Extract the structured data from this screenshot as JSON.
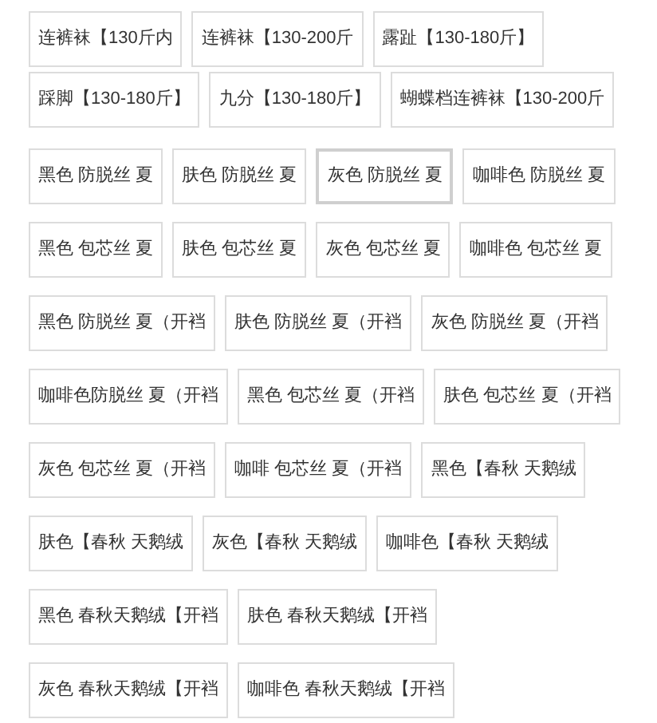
{
  "option_groups": [
    {
      "rows": [
        [
          {
            "label": "连裤袜【130斤内",
            "selected": false
          },
          {
            "label": "连裤袜【130-200斤",
            "selected": false
          },
          {
            "label": "露趾【130-180斤】",
            "selected": false
          }
        ],
        [
          {
            "label": "踩脚【130-180斤】",
            "selected": false
          },
          {
            "label": "九分【130-180斤】",
            "selected": false
          },
          {
            "label": "蝴蝶档连裤袜【130-200斤",
            "selected": false
          }
        ]
      ]
    },
    {
      "rows": [
        [
          {
            "label": "黑色 防脱丝 夏",
            "selected": false
          },
          {
            "label": "肤色 防脱丝 夏",
            "selected": false
          },
          {
            "label": "灰色 防脱丝 夏",
            "selected": true
          },
          {
            "label": "咖啡色 防脱丝 夏",
            "selected": false
          }
        ],
        [
          {
            "label": "黑色 包芯丝 夏",
            "selected": false
          },
          {
            "label": "肤色 包芯丝 夏",
            "selected": false
          },
          {
            "label": "灰色 包芯丝 夏",
            "selected": false
          },
          {
            "label": "咖啡色 包芯丝 夏",
            "selected": false
          }
        ],
        [
          {
            "label": "黑色 防脱丝 夏（开裆",
            "selected": false
          },
          {
            "label": "肤色 防脱丝 夏（开裆",
            "selected": false
          },
          {
            "label": "灰色 防脱丝 夏（开裆",
            "selected": false
          }
        ],
        [
          {
            "label": "咖啡色防脱丝 夏（开裆",
            "selected": false
          },
          {
            "label": "黑色 包芯丝 夏（开裆",
            "selected": false
          },
          {
            "label": "肤色 包芯丝 夏（开裆",
            "selected": false
          }
        ],
        [
          {
            "label": "灰色 包芯丝 夏（开裆",
            "selected": false
          },
          {
            "label": "咖啡 包芯丝 夏（开裆",
            "selected": false
          },
          {
            "label": "黑色【春秋 天鹅绒",
            "selected": false
          }
        ],
        [
          {
            "label": "肤色【春秋 天鹅绒",
            "selected": false
          },
          {
            "label": "灰色【春秋 天鹅绒",
            "selected": false
          },
          {
            "label": "咖啡色【春秋 天鹅绒",
            "selected": false
          }
        ],
        [
          {
            "label": "黑色 春秋天鹅绒【开裆",
            "selected": false
          },
          {
            "label": "肤色 春秋天鹅绒【开裆",
            "selected": false
          }
        ],
        [
          {
            "label": "灰色 春秋天鹅绒【开裆",
            "selected": false
          },
          {
            "label": "咖啡色 春秋天鹅绒【开裆",
            "selected": false
          }
        ]
      ]
    }
  ]
}
